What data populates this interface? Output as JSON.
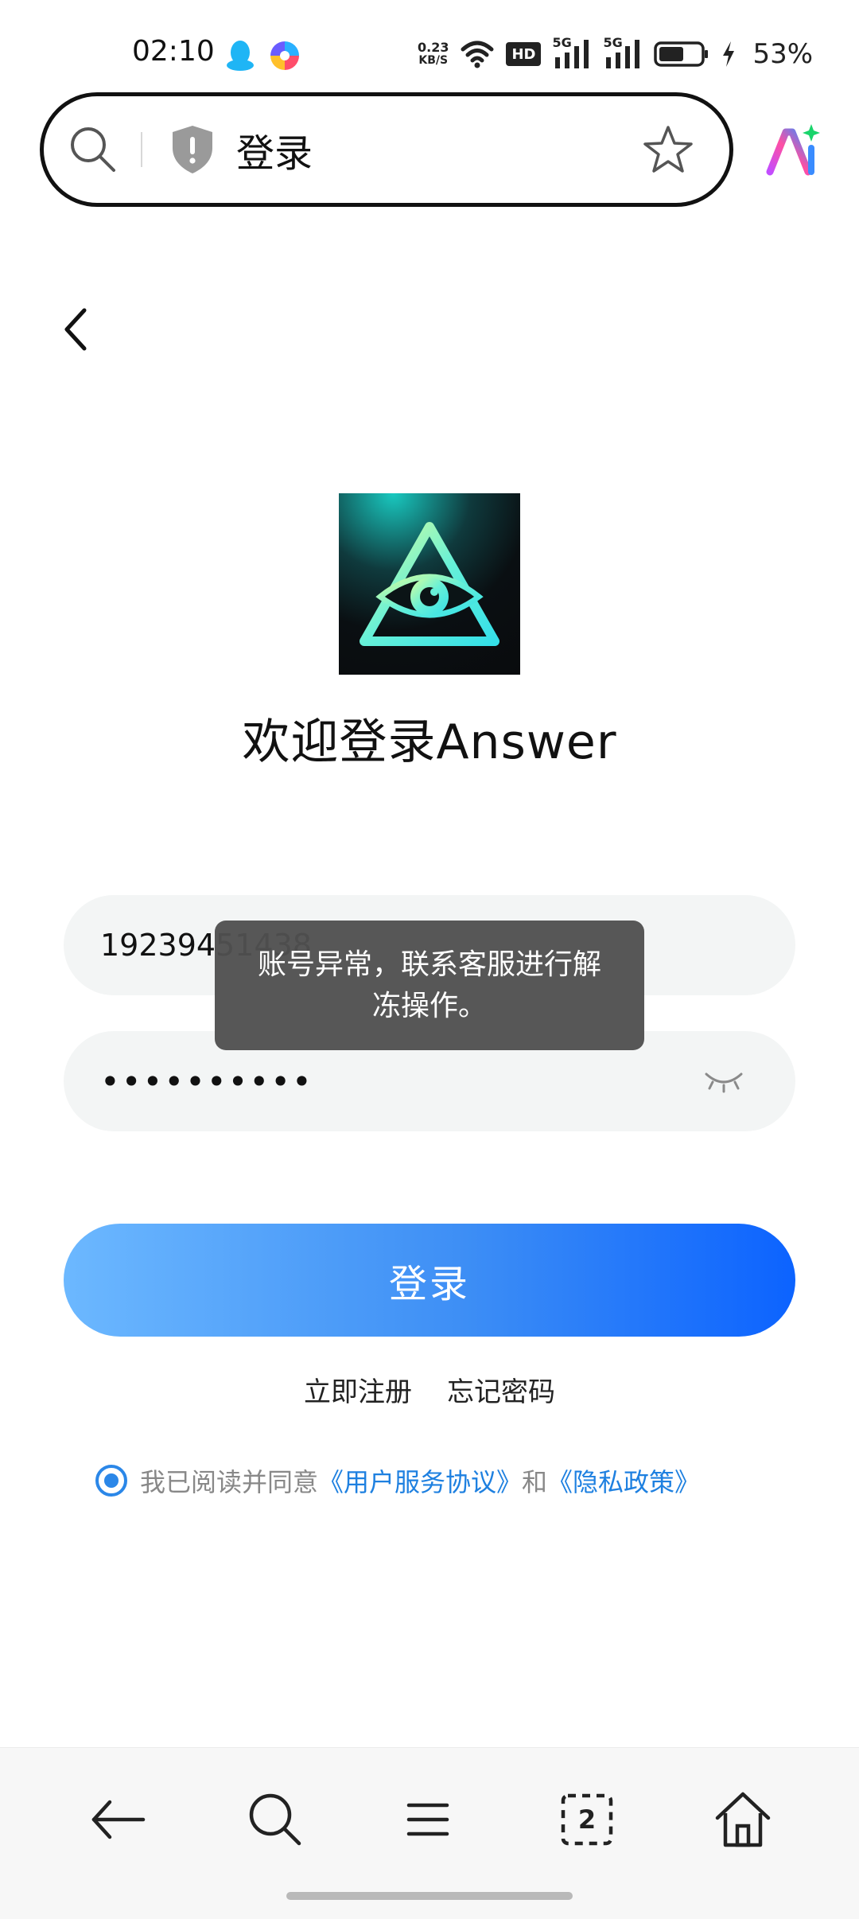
{
  "status_bar": {
    "time": "02:10",
    "speed_value": "0.23",
    "speed_unit": "KB/S",
    "hd_label": "HD",
    "signal1_label": "5G",
    "signal2_label": "5G",
    "battery_percent": "53%"
  },
  "address_bar": {
    "title": "登录"
  },
  "app": {
    "welcome_text": "欢迎登录Answer"
  },
  "form": {
    "phone_value": "19239451438",
    "password_value": "••••••••••"
  },
  "toast": {
    "message": "账号异常，联系客服进行解冻操作。"
  },
  "actions": {
    "login_label": "登录",
    "register_label": "立即注册",
    "forgot_label": "忘记密码"
  },
  "agreement": {
    "prefix": "我已阅读并同意",
    "user_agreement": "《用户服务协议》",
    "and": "和",
    "privacy_policy": "《隐私政策》"
  },
  "bottom_nav": {
    "tabs_count": "2"
  },
  "colors": {
    "primary_blue": "#0c63ff",
    "link_blue": "#1e80e0"
  }
}
